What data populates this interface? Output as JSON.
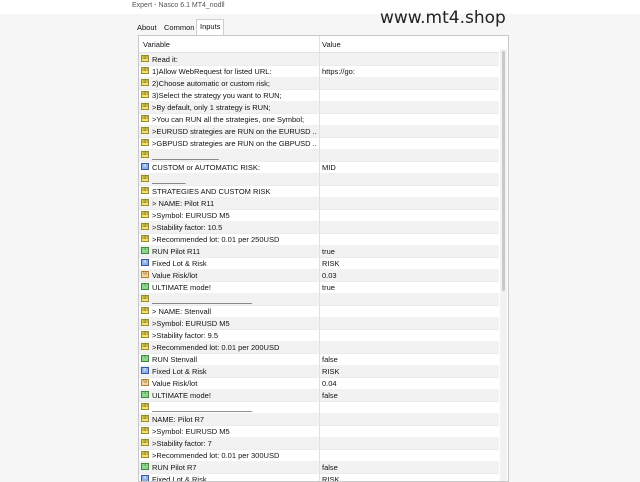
{
  "window": {
    "title": "Expert - Nasco 6.1 MT4_nodll",
    "watermark": "www.mt4.shop"
  },
  "tabs": [
    {
      "label": "About"
    },
    {
      "label": "Common"
    },
    {
      "label": "Inputs"
    }
  ],
  "table": {
    "headers": [
      "Variable",
      "Value"
    ],
    "rows": [
      {
        "icon": "ab",
        "variable": "Read it:",
        "value": ""
      },
      {
        "icon": "ab",
        "variable": "1)Allow WebRequest for listed URL:",
        "value": "https://go:"
      },
      {
        "icon": "ab",
        "variable": "2)Choose automatic or custom risk;",
        "value": ""
      },
      {
        "icon": "ab",
        "variable": "3)Select the strategy you want to RUN;",
        "value": ""
      },
      {
        "icon": "ab",
        "variable": ">By default, only 1 strategy is RUN;",
        "value": ""
      },
      {
        "icon": "ab",
        "variable": ">You can RUN all the strategies, one Symbol;",
        "value": ""
      },
      {
        "icon": "ab",
        "variable": ">EURUSD strategies are RUN on the EURUSD ...",
        "value": ""
      },
      {
        "icon": "ab",
        "variable": ">GBPUSD strategies are RUN on the GBPUSD ...",
        "value": ""
      },
      {
        "icon": "ab",
        "variable": "________________",
        "value": ""
      },
      {
        "icon": "ls",
        "variable": "CUSTOM or AUTOMATIC RISK:",
        "value": "MID"
      },
      {
        "icon": "ab",
        "variable": "________",
        "value": ""
      },
      {
        "icon": "ab",
        "variable": "STRATEGIES AND CUSTOM RISK",
        "value": ""
      },
      {
        "icon": "ab",
        "variable": "> NAME: Pilot R11",
        "value": ""
      },
      {
        "icon": "ab",
        "variable": ">Symbol: EURUSD M5",
        "value": ""
      },
      {
        "icon": "ab",
        "variable": ">Stability factor: 10.5",
        "value": ""
      },
      {
        "icon": "ab",
        "variable": ">Recommended lot: 0.01 per 250USD",
        "value": ""
      },
      {
        "icon": "tf",
        "variable": "RUN Pilot R11",
        "value": "true"
      },
      {
        "icon": "ls",
        "variable": "Fixed Lot & Risk",
        "value": "RISK"
      },
      {
        "icon": "num",
        "variable": "Value Risk/lot",
        "value": "0.03"
      },
      {
        "icon": "tf",
        "variable": "ULTIMATE mode!",
        "value": "true"
      },
      {
        "icon": "ab",
        "variable": "________________________",
        "value": ""
      },
      {
        "icon": "ab",
        "variable": "> NAME: Stenvall",
        "value": ""
      },
      {
        "icon": "ab",
        "variable": ">Symbol: EURUSD M5",
        "value": ""
      },
      {
        "icon": "ab",
        "variable": ">Stability factor: 9.5",
        "value": ""
      },
      {
        "icon": "ab",
        "variable": ">Recommended lot: 0.01 per 200USD",
        "value": ""
      },
      {
        "icon": "tf",
        "variable": "RUN Stenvall",
        "value": "false"
      },
      {
        "icon": "ls",
        "variable": "Fixed Lot & Risk",
        "value": "RISK"
      },
      {
        "icon": "num",
        "variable": "Value Risk/lot",
        "value": "0.04"
      },
      {
        "icon": "tf",
        "variable": "ULTIMATE mode!",
        "value": "false"
      },
      {
        "icon": "ab",
        "variable": "________________________",
        "value": ""
      },
      {
        "icon": "ab",
        "variable": "NAME: Pilot R7",
        "value": ""
      },
      {
        "icon": "ab",
        "variable": ">Symbol: EURUSD M5",
        "value": ""
      },
      {
        "icon": "ab",
        "variable": ">Stability factor: 7",
        "value": ""
      },
      {
        "icon": "ab",
        "variable": ">Recommended lot: 0.01 per 300USD",
        "value": ""
      },
      {
        "icon": "tf",
        "variable": "RUN Pilot R7",
        "value": "false"
      },
      {
        "icon": "ls",
        "variable": "Fixed Lot & Risk",
        "value": "RISK"
      }
    ]
  }
}
